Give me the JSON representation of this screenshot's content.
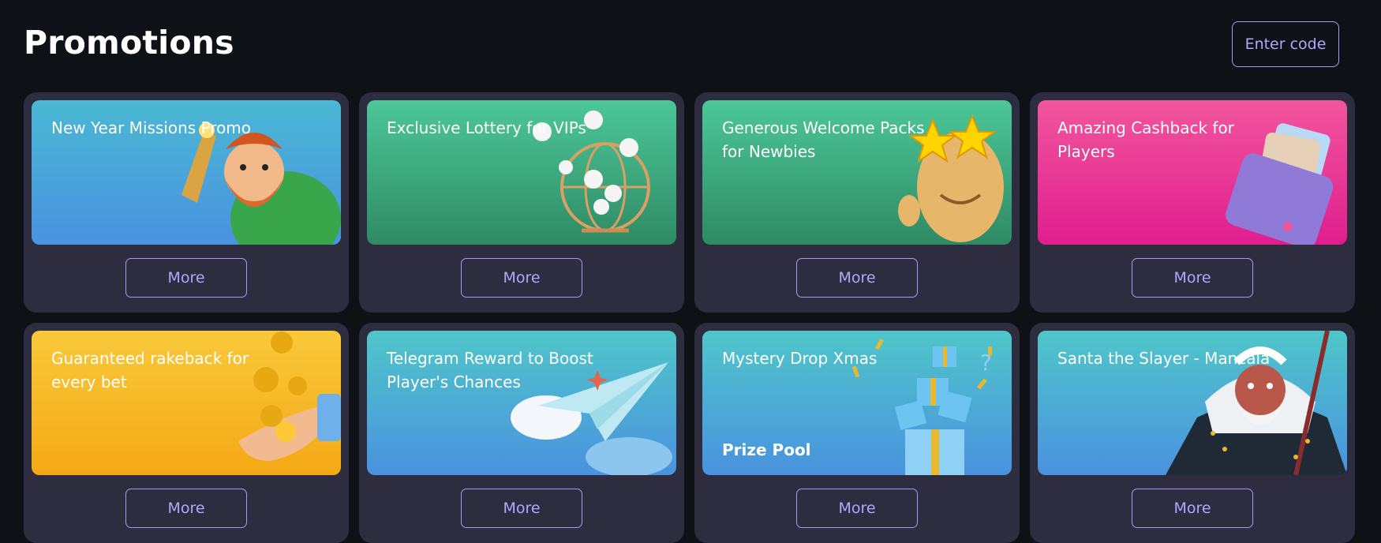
{
  "page": {
    "title": "Promotions",
    "enter_code_label": "Enter code"
  },
  "colors": {
    "background": "#0e1116",
    "card": "#2e2d40",
    "accent": "#b3a6ff"
  },
  "promotions": [
    {
      "title": "New Year Missions Promo",
      "more_label": "More",
      "theme": "blue",
      "art": "viking-character-icon"
    },
    {
      "title": "Exclusive Lottery for VIPs",
      "more_label": "More",
      "theme": "green",
      "art": "lottery-drum-icon"
    },
    {
      "title": "Generous Welcome Packs for Newbies",
      "more_label": "More",
      "theme": "green",
      "art": "star-glasses-character-icon"
    },
    {
      "title": "Amazing Cashback for Players",
      "more_label": "More",
      "theme": "pink",
      "art": "wallet-icon"
    },
    {
      "title": "Guaranteed rakeback for every bet",
      "more_label": "More",
      "theme": "yellow",
      "art": "coins-hand-icon"
    },
    {
      "title": "Telegram Reward to Boost Player's Chances",
      "more_label": "More",
      "theme": "teal",
      "art": "paper-plane-icon"
    },
    {
      "title": "Mystery Drop Xmas",
      "subtitle": "Prize Pool",
      "more_label": "More",
      "theme": "teal",
      "art": "gift-boxes-icon"
    },
    {
      "title": "Santa the Slayer - Mancala",
      "more_label": "More",
      "theme": "teal",
      "art": "warrior-santa-icon"
    }
  ]
}
